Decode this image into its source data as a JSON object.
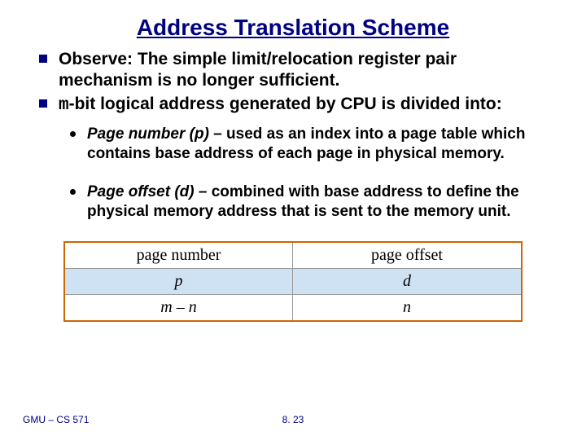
{
  "title": "Address Translation Scheme",
  "bullets": [
    {
      "text": "Observe: The simple limit/relocation register pair mechanism is no longer sufficient."
    },
    {
      "prefix_mono": "m",
      "text": "-bit logical address generated by CPU is divided into:"
    }
  ],
  "sub_bullets": [
    {
      "lead_ital": "Page number (p)",
      "rest": " – used as an index into a page table which contains base address of each page in physical memory."
    },
    {
      "lead_ital": "Page offset (d)",
      "rest": " – combined with base address to define the physical memory address that is sent to the memory unit."
    }
  ],
  "diagram": {
    "header": [
      "page number",
      "page offset"
    ],
    "middle": [
      "p",
      "d"
    ],
    "bottom": [
      "m – n",
      "n"
    ]
  },
  "footer": {
    "left": "GMU – CS 571",
    "center": "8. 23"
  }
}
